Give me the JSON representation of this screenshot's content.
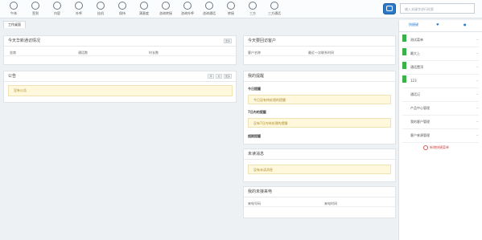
{
  "toolbar": {
    "items": [
      {
        "label": "午休",
        "icon": "clock-icon"
      },
      {
        "label": "签到",
        "icon": "checkin-icon"
      },
      {
        "label": "内容",
        "icon": "content-icon"
      },
      {
        "label": "外呼",
        "icon": "phone-icon"
      },
      {
        "label": "挂机",
        "icon": "hangup-icon"
      },
      {
        "label": "保持",
        "icon": "hold-icon"
      },
      {
        "label": "满意度",
        "icon": "satisfaction-icon"
      },
      {
        "label": "咨询转接",
        "icon": "consult-icon"
      },
      {
        "label": "咨询外呼",
        "icon": "consult-call-icon"
      },
      {
        "label": "咨询通话",
        "icon": "consult-talk-icon"
      },
      {
        "label": "转接",
        "icon": "transfer-icon"
      },
      {
        "label": "三方",
        "icon": "threeway-icon"
      },
      {
        "label": "三方通话",
        "icon": "threeway-talk-icon"
      }
    ],
    "search_placeholder": "输入关键字进行检索"
  },
  "tabs": {
    "active": "工作桌面"
  },
  "left_panel_top": {
    "title": "今天华新通访情况",
    "button": "更多",
    "columns": [
      "坐席",
      "通话数",
      "时长数"
    ]
  },
  "left_panel_notice": {
    "title": "公告",
    "buttons": [
      "添",
      "加",
      "更多"
    ],
    "empty_text": "没有公告"
  },
  "right_today_customers": {
    "title": "今天要回访客户",
    "columns": [
      "客户名称",
      "最近一次联系时间"
    ]
  },
  "my_reminders": {
    "title": "我的提醒",
    "today_label": "今日提醒",
    "today_text": "今日没有待处理的提醒",
    "week_label": "7日内的提醒",
    "week_text": "没有7日内待处理的提醒",
    "overdue_label": "超期提醒"
  },
  "unread_messages": {
    "title": "未读消息",
    "empty_text": "没有未读消息"
  },
  "missed_calls": {
    "title": "我的未接来电",
    "columns": [
      "来电号码",
      "来电时间"
    ]
  },
  "sidepanel": {
    "tabs": [
      "快捷键",
      "收藏",
      "联系人"
    ],
    "items": [
      "测试菜单",
      "最大上",
      "通话置顶",
      "123",
      "通话记",
      "产品中心管理",
      "我的客户管理",
      "客户来源管理"
    ],
    "add_label": "新增快捷菜单"
  }
}
